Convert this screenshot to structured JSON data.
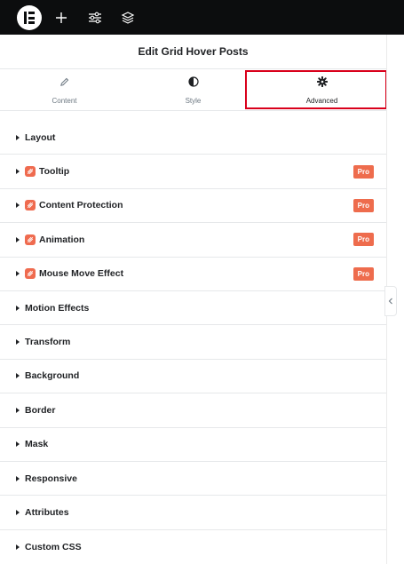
{
  "panel": {
    "title": "Edit Grid Hover Posts"
  },
  "tabs": [
    {
      "label": "Content",
      "icon": "pencil-icon"
    },
    {
      "label": "Style",
      "icon": "half-circle-icon"
    },
    {
      "label": "Advanced",
      "icon": "gear-icon",
      "active": true
    }
  ],
  "pro_label": "Pro",
  "sections": [
    {
      "title": "Layout",
      "pro": false
    },
    {
      "title": "Tooltip",
      "pro": true
    },
    {
      "title": "Content Protection",
      "pro": true
    },
    {
      "title": "Animation",
      "pro": true
    },
    {
      "title": "Mouse Move Effect",
      "pro": true
    },
    {
      "title": "Motion Effects",
      "pro": false
    },
    {
      "title": "Transform",
      "pro": false
    },
    {
      "title": "Background",
      "pro": false
    },
    {
      "title": "Border",
      "pro": false
    },
    {
      "title": "Mask",
      "pro": false
    },
    {
      "title": "Responsive",
      "pro": false
    },
    {
      "title": "Attributes",
      "pro": false
    },
    {
      "title": "Custom CSS",
      "pro": false
    }
  ],
  "colors": {
    "accent": "#d9001b",
    "pro": "#ee6c4d",
    "topbar": "#0c0d0e"
  }
}
